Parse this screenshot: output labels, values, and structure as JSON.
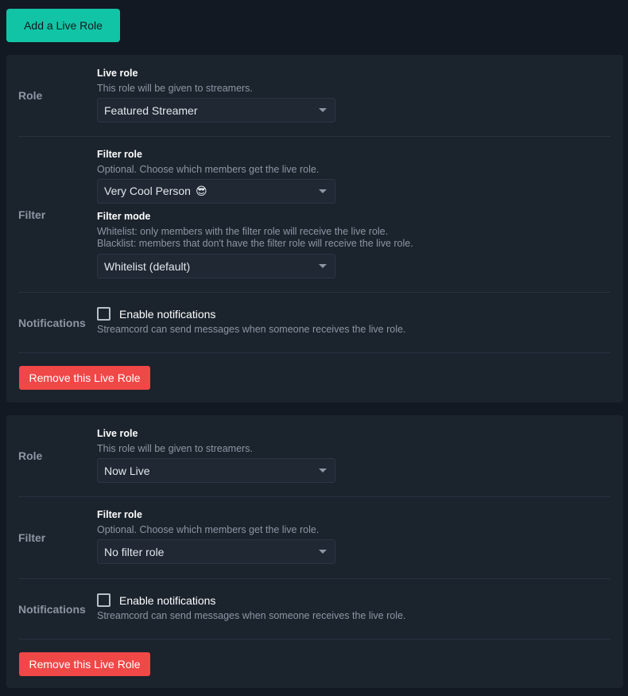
{
  "header": {
    "add_button_label": "Add a Live Role"
  },
  "cards": [
    {
      "role_label": "Role",
      "live_role_title": "Live role",
      "live_role_desc": "This role will be given to streamers.",
      "live_role_value": "Featured Streamer",
      "filter_label": "Filter",
      "filter_role_title": "Filter role",
      "filter_role_desc": "Optional. Choose which members get the live role.",
      "filter_role_value": "Very Cool Person",
      "filter_role_emoji": "😎",
      "filter_mode_title": "Filter mode",
      "filter_mode_desc_1": "Whitelist: only members with the filter role will receive the live role.",
      "filter_mode_desc_2": "Blacklist: members that don't have the filter role will receive the live role.",
      "filter_mode_value": "Whitelist (default)",
      "notifications_label": "Notifications",
      "notifications_checkbox_label": "Enable notifications",
      "notifications_checked": false,
      "notifications_desc": "Streamcord can send messages when someone receives the live role.",
      "remove_button_label": "Remove this Live Role"
    },
    {
      "role_label": "Role",
      "live_role_title": "Live role",
      "live_role_desc": "This role will be given to streamers.",
      "live_role_value": "Now Live",
      "filter_label": "Filter",
      "filter_role_title": "Filter role",
      "filter_role_desc": "Optional. Choose which members get the live role.",
      "filter_role_value": "No filter role",
      "notifications_label": "Notifications",
      "notifications_checkbox_label": "Enable notifications",
      "notifications_checked": false,
      "notifications_desc": "Streamcord can send messages when someone receives the live role.",
      "remove_button_label": "Remove this Live Role"
    }
  ],
  "colors": {
    "accent": "#12c4a6",
    "danger": "#f04747",
    "background": "#131922",
    "card": "#1b232d"
  }
}
